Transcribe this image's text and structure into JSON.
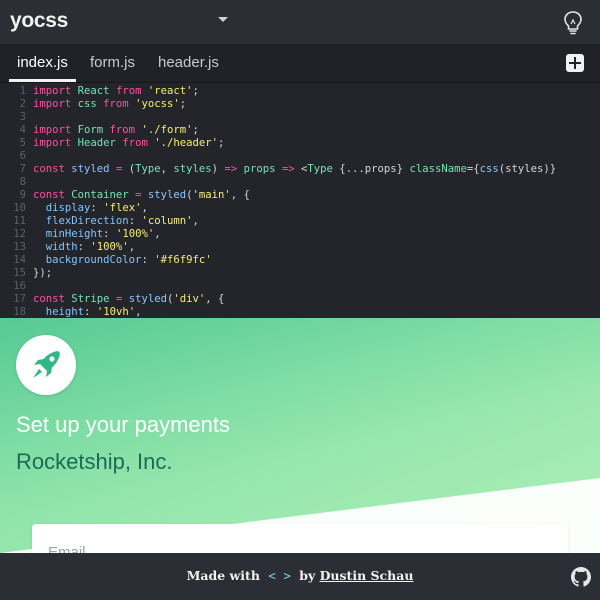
{
  "header": {
    "app_title": "yocss"
  },
  "tabs": [
    {
      "label": "index.js",
      "active": true
    },
    {
      "label": "form.js",
      "active": false
    },
    {
      "label": "header.js",
      "active": false
    }
  ],
  "editor": {
    "lines": [
      {
        "n": "1",
        "tokens": [
          [
            "kw",
            "import "
          ],
          [
            "id",
            "React "
          ],
          [
            "kw",
            "from "
          ],
          [
            "str",
            "'react'"
          ],
          [
            "code",
            ";"
          ]
        ]
      },
      {
        "n": "2",
        "tokens": [
          [
            "kw",
            "import "
          ],
          [
            "id",
            "css "
          ],
          [
            "kw",
            "from "
          ],
          [
            "str",
            "'yocss'"
          ],
          [
            "code",
            ";"
          ]
        ]
      },
      {
        "n": "3",
        "tokens": []
      },
      {
        "n": "4",
        "tokens": [
          [
            "kw",
            "import "
          ],
          [
            "id",
            "Form "
          ],
          [
            "kw",
            "from "
          ],
          [
            "str",
            "'./form'"
          ],
          [
            "code",
            ";"
          ]
        ]
      },
      {
        "n": "5",
        "tokens": [
          [
            "kw",
            "import "
          ],
          [
            "id",
            "Header "
          ],
          [
            "kw",
            "from "
          ],
          [
            "str",
            "'./header'"
          ],
          [
            "code",
            ";"
          ]
        ]
      },
      {
        "n": "6",
        "tokens": []
      },
      {
        "n": "7",
        "tokens": [
          [
            "kw",
            "const "
          ],
          [
            "fn",
            "styled "
          ],
          [
            "op",
            "= "
          ],
          [
            "code",
            "("
          ],
          [
            "id",
            "Type"
          ],
          [
            "code",
            ", "
          ],
          [
            "id",
            "styles"
          ],
          [
            "code",
            ") "
          ],
          [
            "op",
            "=> "
          ],
          [
            "id",
            "props "
          ],
          [
            "op",
            "=> "
          ],
          [
            "code",
            "<"
          ],
          [
            "id",
            "Type "
          ],
          [
            "code",
            "{...props} "
          ],
          [
            "id",
            "className"
          ],
          [
            "code",
            "={"
          ],
          [
            "fn",
            "css"
          ],
          [
            "code",
            "(styles)}"
          ]
        ]
      },
      {
        "n": "8",
        "tokens": []
      },
      {
        "n": "9",
        "tokens": [
          [
            "kw",
            "const "
          ],
          [
            "id",
            "Container "
          ],
          [
            "op",
            "= "
          ],
          [
            "fn",
            "styled"
          ],
          [
            "code",
            "("
          ],
          [
            "str",
            "'main'"
          ],
          [
            "code",
            ", {"
          ]
        ]
      },
      {
        "n": "10",
        "tokens": [
          [
            "code",
            "  "
          ],
          [
            "prop",
            "display"
          ],
          [
            "code",
            ": "
          ],
          [
            "str",
            "'flex'"
          ],
          [
            "code",
            ","
          ]
        ]
      },
      {
        "n": "11",
        "tokens": [
          [
            "code",
            "  "
          ],
          [
            "prop",
            "flexDirection"
          ],
          [
            "code",
            ": "
          ],
          [
            "str",
            "'column'"
          ],
          [
            "code",
            ","
          ]
        ]
      },
      {
        "n": "12",
        "tokens": [
          [
            "code",
            "  "
          ],
          [
            "prop",
            "minHeight"
          ],
          [
            "code",
            ": "
          ],
          [
            "str",
            "'100%'"
          ],
          [
            "code",
            ","
          ]
        ]
      },
      {
        "n": "13",
        "tokens": [
          [
            "code",
            "  "
          ],
          [
            "prop",
            "width"
          ],
          [
            "code",
            ": "
          ],
          [
            "str",
            "'100%'"
          ],
          [
            "code",
            ","
          ]
        ]
      },
      {
        "n": "14",
        "tokens": [
          [
            "code",
            "  "
          ],
          [
            "prop",
            "backgroundColor"
          ],
          [
            "code",
            ": "
          ],
          [
            "str",
            "'#f6f9fc'"
          ]
        ]
      },
      {
        "n": "15",
        "tokens": [
          [
            "code",
            "});"
          ]
        ]
      },
      {
        "n": "16",
        "tokens": []
      },
      {
        "n": "17",
        "tokens": [
          [
            "kw",
            "const "
          ],
          [
            "id",
            "Stripe "
          ],
          [
            "op",
            "= "
          ],
          [
            "fn",
            "styled"
          ],
          [
            "code",
            "("
          ],
          [
            "str",
            "'div'"
          ],
          [
            "code",
            ", {"
          ]
        ]
      },
      {
        "n": "18",
        "tokens": [
          [
            "code",
            "  "
          ],
          [
            "prop",
            "height"
          ],
          [
            "code",
            ": "
          ],
          [
            "str",
            "'10vh'"
          ],
          [
            "code",
            ","
          ]
        ]
      }
    ]
  },
  "preview": {
    "heading": "Set up your payments",
    "company": "Rocketship, Inc.",
    "email_label": "Email"
  },
  "footer": {
    "made_with": "Made with",
    "code_glyph": "< >",
    "by": "by",
    "author": "Dustin Schau"
  },
  "colors": {
    "accent_green": "#3bbf8f",
    "editor_bg": "#23252b",
    "bar_bg": "#2b2e34"
  },
  "icons": {
    "settings": "lightbulb-icon",
    "add": "add-file-icon",
    "logo": "rocket-icon",
    "repo": "github-icon"
  }
}
